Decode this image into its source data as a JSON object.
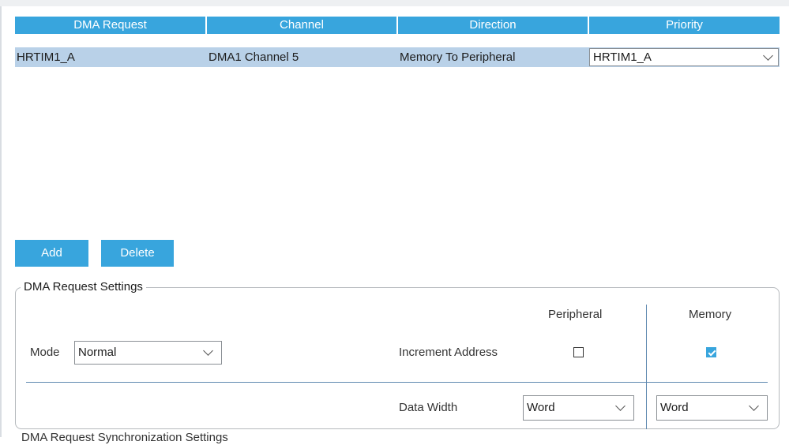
{
  "table": {
    "headers": [
      "DMA Request",
      "Channel",
      "Direction",
      "Priority"
    ],
    "rows": [
      {
        "request": "HRTIM1_A",
        "channel": "DMA1 Channel 5",
        "direction": "Memory To Peripheral",
        "priority": "HRTIM1_A"
      }
    ]
  },
  "buttons": {
    "add": "Add",
    "delete": "Delete"
  },
  "settings": {
    "title": "DMA Request Settings",
    "mode_label": "Mode",
    "mode_value": "Normal",
    "col_peripheral": "Peripheral",
    "col_memory": "Memory",
    "increment_label": "Increment Address",
    "increment_peripheral_checked": false,
    "increment_memory_checked": true,
    "data_width_label": "Data Width",
    "data_width_peripheral": "Word",
    "data_width_memory": "Word"
  },
  "next_section_label": "DMA Request Synchronization Settings",
  "colors": {
    "accent": "#38a5dd",
    "row_selected": "#b9d1e8",
    "separator": "#5f89b0"
  }
}
